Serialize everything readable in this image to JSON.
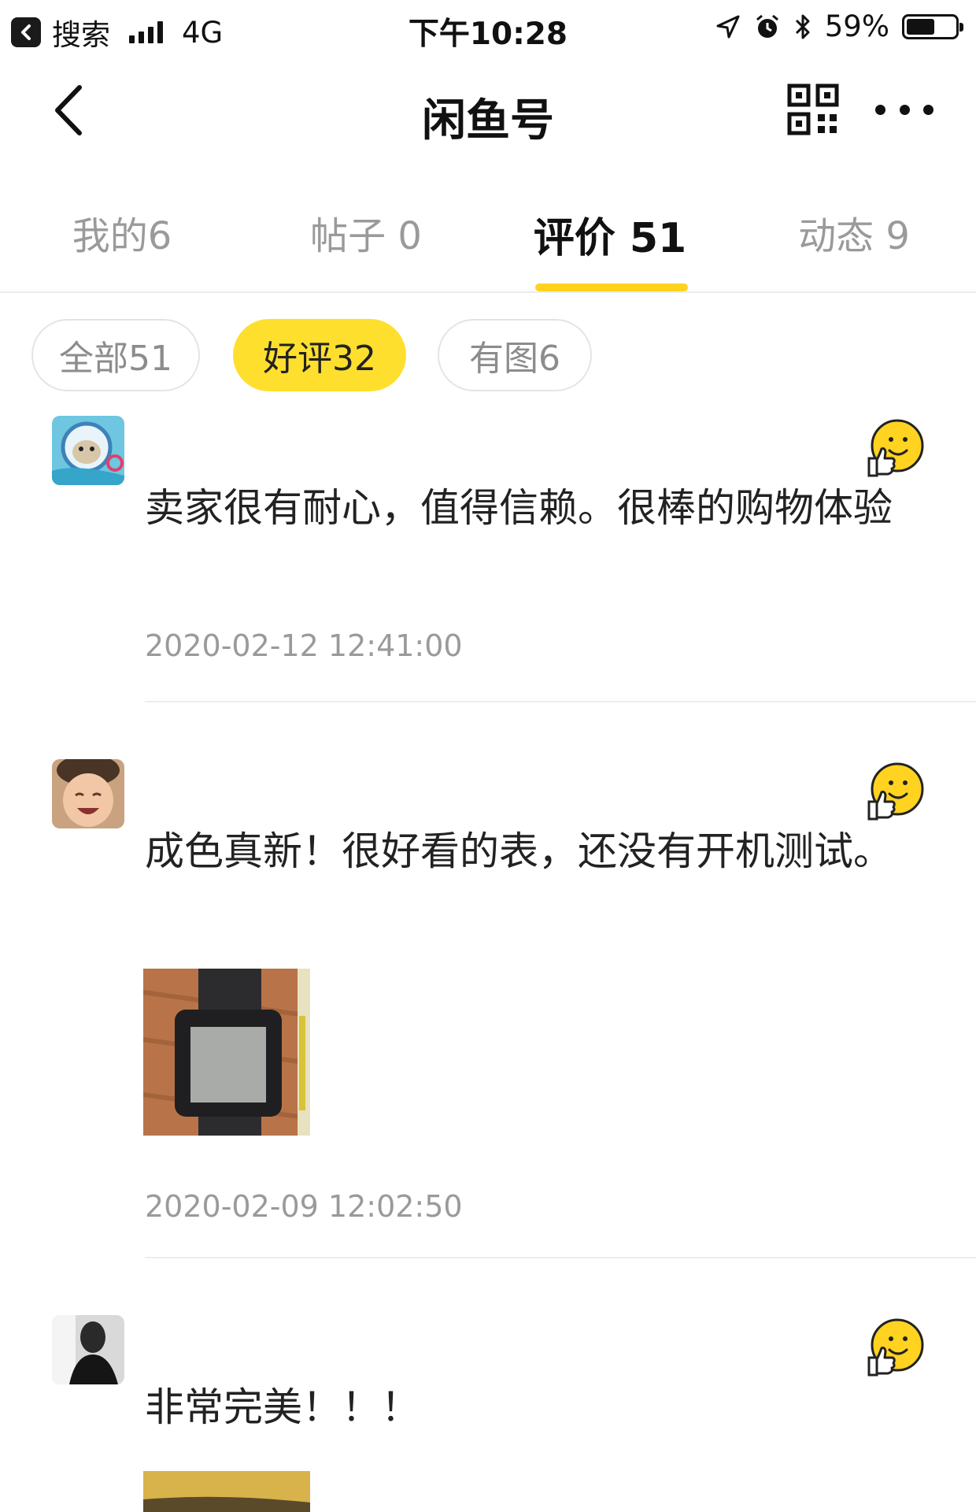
{
  "status_bar": {
    "back_app_label": "搜索",
    "network": "4G",
    "time": "下午10:28",
    "battery": "59%",
    "battery_level": 0.59
  },
  "nav": {
    "title": "闲鱼号",
    "back_icon": "chevron-left-icon",
    "qr_icon": "qr-code-icon",
    "more_icon": "more-dots-icon"
  },
  "tabs": [
    {
      "label": "我的6",
      "active": false
    },
    {
      "label": "帖子 0",
      "active": false
    },
    {
      "label": "评价 51",
      "active": true
    },
    {
      "label": "动态 9",
      "active": false
    }
  ],
  "filters": [
    {
      "label": "全部51",
      "active": false
    },
    {
      "label": "好评32",
      "active": true
    },
    {
      "label": "有图6",
      "active": false
    }
  ],
  "reviews": [
    {
      "name": "",
      "text": "卖家很有耐心，值得信赖。很棒的购物体验",
      "time": "2020-02-12 12:41:00",
      "rating_icon": "happy-thumbs-up-emoji-icon"
    },
    {
      "name": "",
      "text": "成色真新！很好看的表，还没有开机测试。",
      "time": "2020-02-09 12:02:50",
      "rating_icon": "happy-thumbs-up-emoji-icon"
    },
    {
      "name": "",
      "text": "非常完美！！！",
      "time": "",
      "rating_icon": "happy-thumbs-up-emoji-icon"
    }
  ],
  "colors": {
    "accent": "#ffd21e",
    "pill_active": "#ffdf2e",
    "text_primary": "#222222",
    "text_secondary": "#9a9a9a"
  }
}
